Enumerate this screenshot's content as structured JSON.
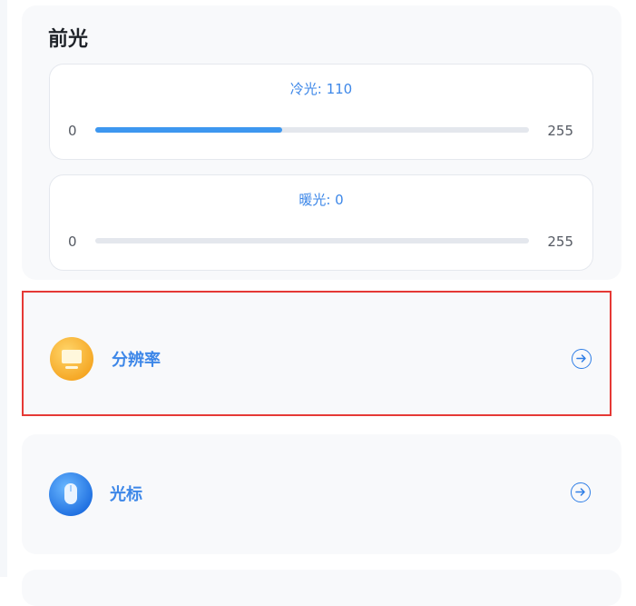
{
  "front_light": {
    "title": "前光",
    "cold": {
      "label": "冷光: 110",
      "value": 110,
      "min": "0",
      "max": "255"
    },
    "warm": {
      "label": "暖光: 0",
      "value": 0,
      "min": "0",
      "max": "255"
    }
  },
  "menu": {
    "resolution": {
      "label": "分辨率",
      "icon": "monitor-icon"
    },
    "cursor": {
      "label": "光标",
      "icon": "mouse-icon"
    }
  },
  "colors": {
    "accent": "#3d97f0",
    "label_blue": "#3d87e8",
    "highlight": "#e53935"
  }
}
